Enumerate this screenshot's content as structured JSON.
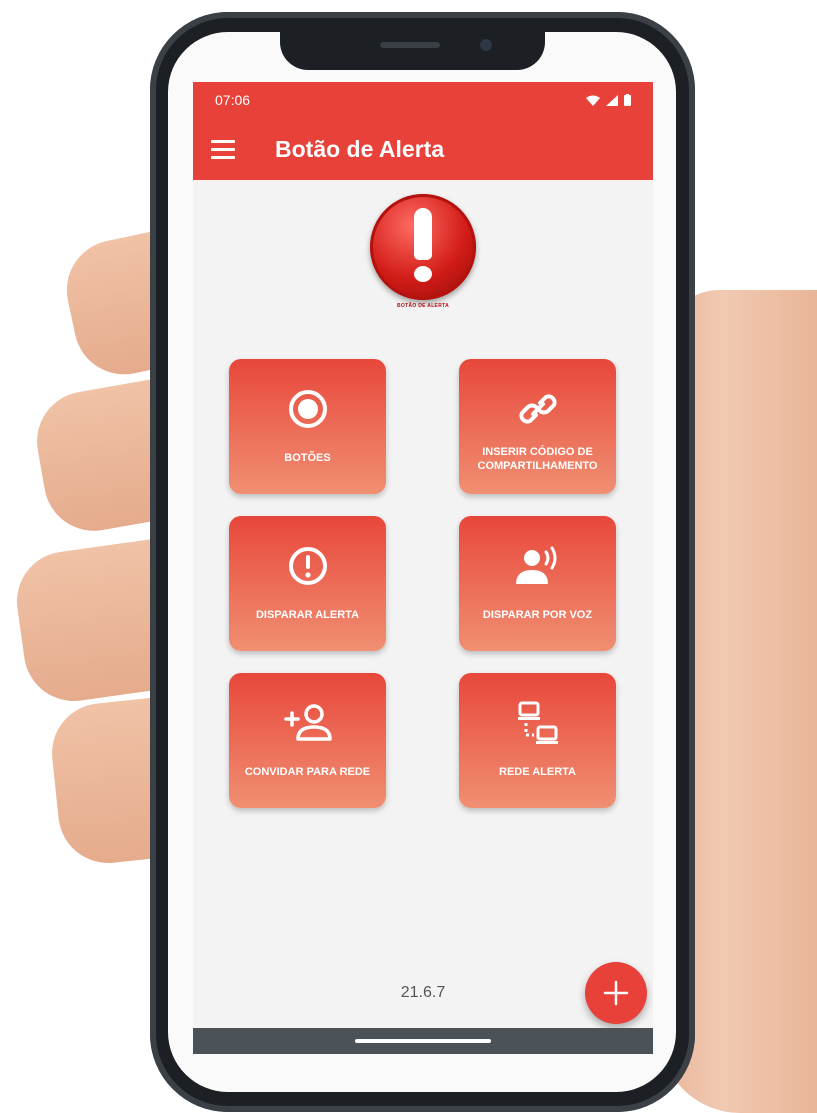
{
  "status_bar": {
    "time": "07:06"
  },
  "app_bar": {
    "title": "Botão de Alerta"
  },
  "logo": {
    "caption": "BOTÃO DE ALERTA"
  },
  "tiles": [
    {
      "label": "BOTÕES",
      "icon": "radio-button-icon"
    },
    {
      "label": "INSERIR CÓDIGO DE COMPARTILHAMENTO",
      "icon": "link-icon"
    },
    {
      "label": "DISPARAR ALERTA",
      "icon": "alert-circle-icon"
    },
    {
      "label": "DISPARAR POR VOZ",
      "icon": "voice-person-icon"
    },
    {
      "label": "CONVIDAR PARA REDE",
      "icon": "add-person-icon"
    },
    {
      "label": "REDE ALERTA",
      "icon": "network-icon"
    }
  ],
  "version": "21.6.7",
  "fab": {
    "icon": "plus-icon"
  },
  "colors": {
    "primary": "#e8413a",
    "tile_gradient_top": "#e8473b",
    "tile_gradient_bottom": "#f08f72"
  }
}
